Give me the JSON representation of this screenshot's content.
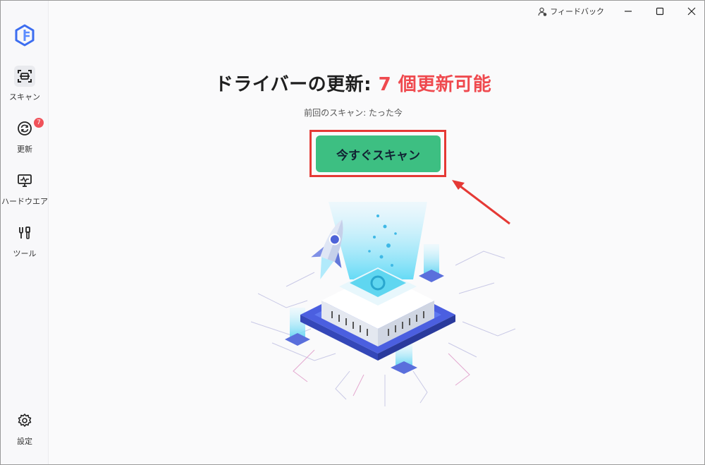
{
  "app": {
    "logo_icon": "app-logo-icon"
  },
  "sidebar": {
    "items": [
      {
        "label": "スキャン",
        "icon": "scan-icon",
        "active": true
      },
      {
        "label": "更新",
        "icon": "refresh-icon",
        "badge": "7"
      },
      {
        "label": "ハードウエア",
        "icon": "hardware-monitor-icon"
      },
      {
        "label": "ツール",
        "icon": "tools-icon"
      }
    ],
    "settings": {
      "label": "設定",
      "icon": "gear-icon"
    }
  },
  "titlebar": {
    "feedback_label": "フィードバック",
    "feedback_icon": "feedback-user-icon",
    "controls": [
      "minimize-icon",
      "maximize-icon",
      "close-icon"
    ]
  },
  "main": {
    "title_prefix": "ドライバーの更新: ",
    "title_highlight": "7 個更新可能",
    "last_scan": "前回のスキャン: たった今",
    "scan_button": "今すぐスキャン"
  },
  "colors": {
    "accent_green": "#3dbf82",
    "highlight_red": "#ef4a4f",
    "annotation_red": "#e53935"
  }
}
